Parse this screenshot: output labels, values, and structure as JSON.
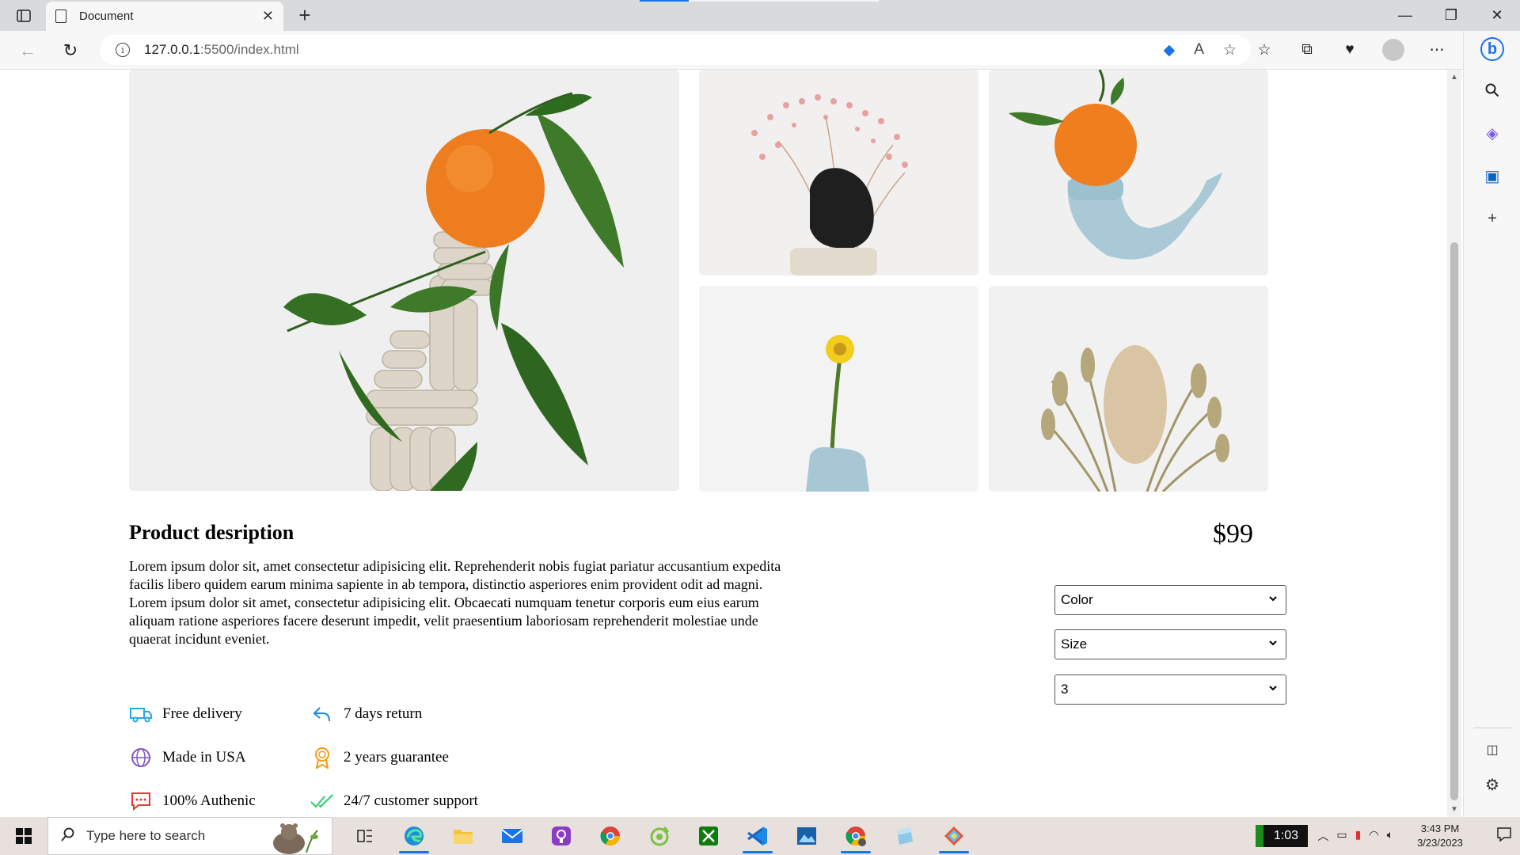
{
  "browser": {
    "tab_title": "Document",
    "url_host": "127.0.0.1",
    "url_path": ":5500/index.html"
  },
  "product": {
    "title": "Product desription",
    "paragraphs": [
      "Lorem ipsum dolor sit, amet consectetur adipisicing elit. Reprehenderit nobis fugiat pariatur accusantium expedita facilis libero quidem earum minima sapiente in ab tempora, distinctio asperiores enim provident odit ad magni.",
      "Lorem ipsum dolor sit amet, consectetur adipisicing elit. Obcaecati numquam tenetur corporis eum eius earum aliquam ratione asperiores facere deserunt impedit, velit praesentium laboriosam reprehenderit molestiae unde quaerat incidunt eveniet."
    ],
    "price": "$99",
    "color_select": "Color",
    "size_select": "Size",
    "quantity_select": "3",
    "features": [
      {
        "label": "Free delivery",
        "icon": "truck-icon",
        "color": "#29a8e0"
      },
      {
        "label": "7 days return",
        "icon": "return-arrow-icon",
        "color": "#1e88e5"
      },
      {
        "label": "Made in USA",
        "icon": "globe-icon",
        "color": "#7e57c2"
      },
      {
        "label": "2 years guarantee",
        "icon": "award-icon",
        "color": "#f39c12"
      },
      {
        "label": "100% Authenic",
        "icon": "chat-icon",
        "color": "#e53935"
      },
      {
        "label": "24/7 customer support",
        "icon": "double-check-icon",
        "color": "#2ecc71"
      }
    ]
  },
  "taskbar": {
    "search_placeholder": "Type here to search",
    "badge_time": "1:03",
    "time": "3:43 PM",
    "date": "3/23/2023"
  },
  "colors": {
    "accent": "#1a73e8",
    "image_bg": "#efefef"
  }
}
